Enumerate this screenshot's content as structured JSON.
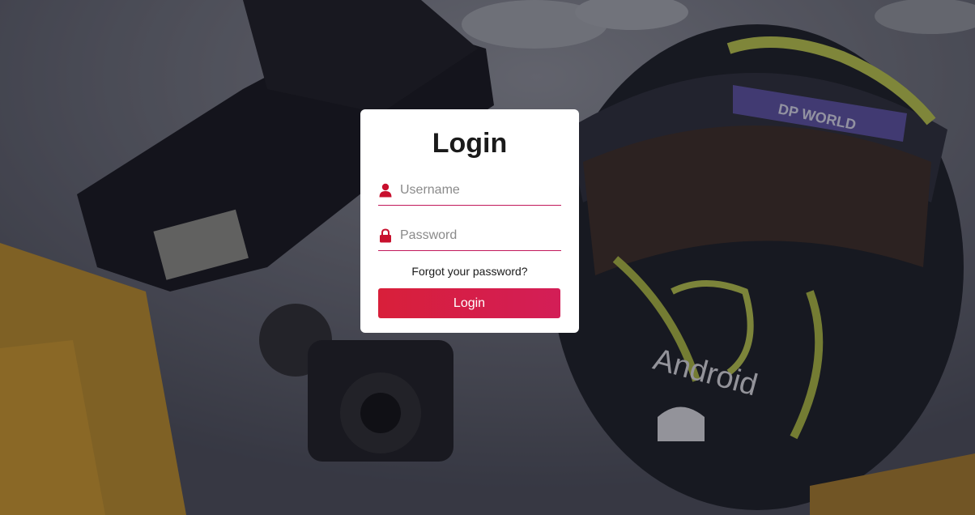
{
  "login": {
    "title": "Login",
    "username_placeholder": "Username",
    "password_placeholder": "Password",
    "forgot_link": "Forgot your password?",
    "submit_label": "Login"
  },
  "background": {
    "helmet_text_android": "Android",
    "helmet_text_sponsor": "DP WORLD"
  },
  "colors": {
    "accent": "#d31e45",
    "input_underline": "#c2185b",
    "icon": "#c8102e"
  },
  "icons": {
    "username": "user-icon",
    "password": "lock-icon"
  }
}
